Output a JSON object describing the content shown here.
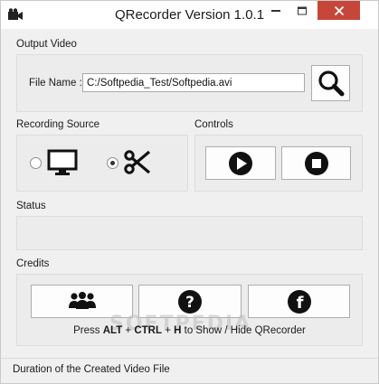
{
  "window": {
    "title": "QRecorder Version 1.0.1"
  },
  "output_video": {
    "section_label": "Output Video",
    "file_name_label": "File Name :",
    "file_name_value": "C:/Softpedia_Test/Softpedia.avi",
    "browse_icon": "magnifier-icon"
  },
  "recording_source": {
    "section_label": "Recording Source",
    "options": [
      {
        "icon": "monitor-icon",
        "selected": false
      },
      {
        "icon": "scissors-icon",
        "selected": true
      }
    ]
  },
  "controls": {
    "section_label": "Controls",
    "buttons": [
      {
        "icon": "play-icon"
      },
      {
        "icon": "stop-icon"
      }
    ]
  },
  "status": {
    "section_label": "Status",
    "text": ""
  },
  "credits": {
    "section_label": "Credits",
    "buttons": [
      {
        "icon": "people-icon"
      },
      {
        "icon": "question-icon"
      },
      {
        "icon": "facebook-icon"
      }
    ],
    "hint_prefix": "Press ",
    "hint_keys": [
      "ALT",
      "CTRL",
      "H"
    ],
    "hint_joiner": " + ",
    "hint_suffix": " to Show / Hide QRecorder",
    "watermark": "SOFTPEDIA"
  },
  "footer": {
    "text": "Duration of the Created Video File"
  },
  "colors": {
    "close_button": "#c7463a",
    "window_bg": "#f0f0f0",
    "group_bg": "#ececec"
  }
}
